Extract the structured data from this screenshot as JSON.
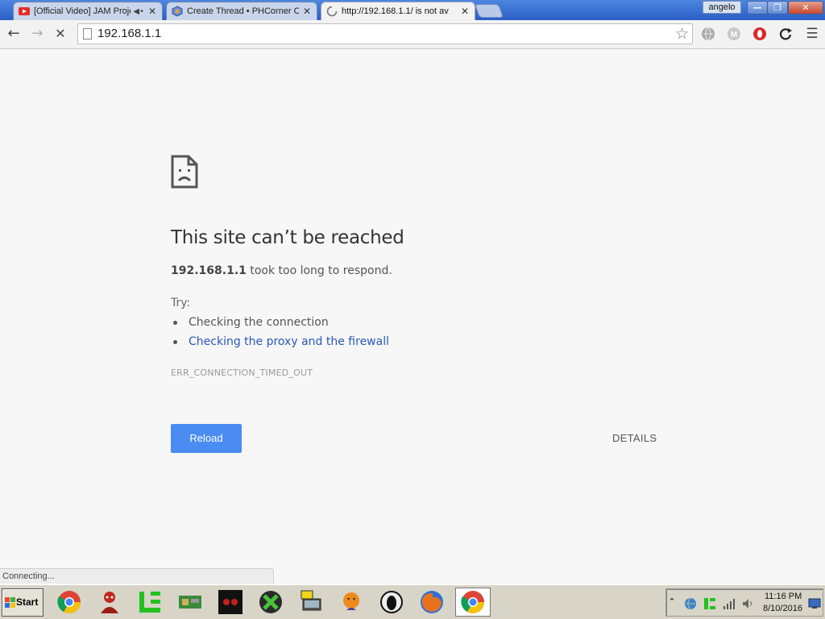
{
  "window": {
    "user": "angelo",
    "minimize_glyph": "—",
    "restore_glyph": "❐",
    "close_glyph": "✕"
  },
  "tabs": [
    {
      "title": "[Official Video] JAM Proje",
      "favicon": "youtube-icon",
      "muted_icon": "speaker-icon",
      "active": false
    },
    {
      "title": "Create Thread • PHCorner C",
      "favicon": "phcorner-icon",
      "active": false
    },
    {
      "title": "http://192.168.1.1/ is not av",
      "favicon": "loading-spinner-icon",
      "active": true
    }
  ],
  "toolbar": {
    "url": "192.168.1.1",
    "back_icon": "back-arrow-icon",
    "forward_icon": "forward-arrow-icon",
    "stop_icon": "stop-icon",
    "bookmark_icon": "star-icon",
    "extensions": [
      "extension-globe-icon",
      "extension-m-icon",
      "extension-opera-icon",
      "extension-sync-icon"
    ],
    "menu_icon": "hamburger-menu-icon"
  },
  "error_page": {
    "icon": "sad-page-icon",
    "heading": "This site can’t be reached",
    "host": "192.168.1.1",
    "summary_rest": " took too long to respond.",
    "try_label": "Try:",
    "suggestions": [
      {
        "text": "Checking the connection",
        "link": false
      },
      {
        "text": "Checking the proxy and the firewall",
        "link": true
      }
    ],
    "error_code": "ERR_CONNECTION_TIMED_OUT",
    "reload_label": "Reload",
    "details_label": "DETAILS"
  },
  "status_bubble": {
    "text": "Connecting..."
  },
  "taskbar": {
    "start_label": "Start",
    "apps": [
      "chrome-icon",
      "red-character-icon",
      "green-le-icon",
      "network-card-icon",
      "dark-logo-icon",
      "green-cross-icon",
      "computer-terminal-icon",
      "pumpkin-character-icon",
      "anonymous-mask-icon",
      "firefox-icon",
      "chrome-active-icon"
    ],
    "clock_time": "11:16 PM",
    "clock_date": "8/10/2016"
  },
  "colors": {
    "reload_button": "#4a8cf2",
    "link": "#2a59b8",
    "page_bg": "#f7f7f7",
    "titlebar": "#2a5ec4"
  }
}
